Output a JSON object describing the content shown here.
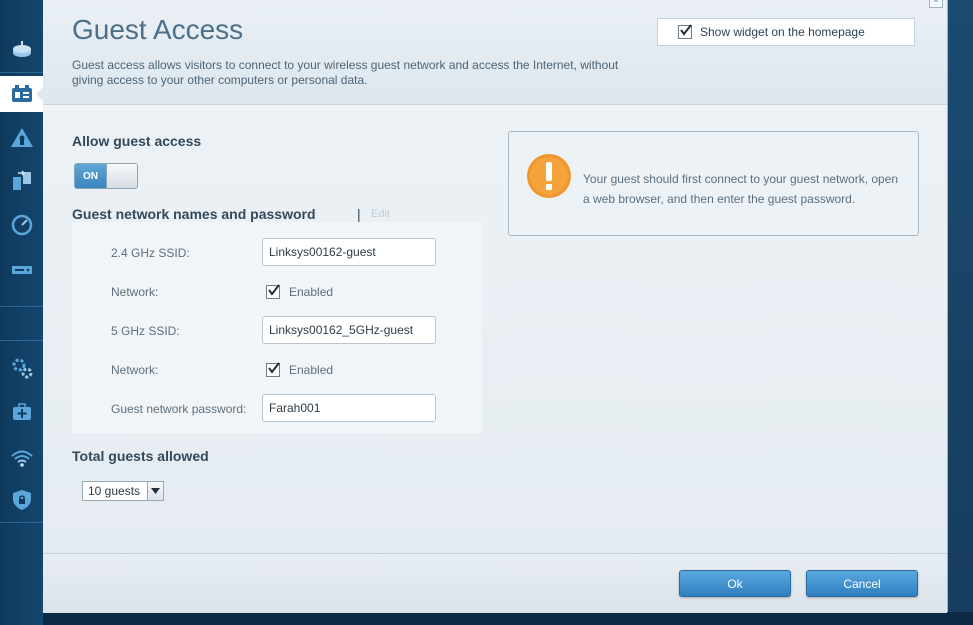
{
  "header": {
    "title": "Guest Access",
    "description": "Guest access allows visitors to connect to your wireless guest network and access the Internet, without giving access to your other computers or personal data.",
    "show_widget_label": "Show widget on the homepage",
    "show_widget_checked": true
  },
  "allow_guest": {
    "title": "Allow guest access",
    "toggle_label": "ON",
    "toggle_state": "on"
  },
  "network": {
    "title": "Guest network names and password",
    "separator": "|",
    "edit_label": "Edit",
    "ssid24_label": "2.4 GHz SSID:",
    "ssid24_value": "Linksys00162-guest",
    "network24_label": "Network:",
    "network24_checkbox_label": "Enabled",
    "ssid5_label": "5 GHz SSID:",
    "ssid5_value": "Linksys00162_5GHz-guest",
    "network5_label": "Network:",
    "network5_checkbox_label": "Enabled",
    "password_label": "Guest network password:",
    "password_value": "Farah001"
  },
  "guests": {
    "title": "Total guests allowed",
    "selected": "10 guests"
  },
  "info": {
    "message": "Your guest should first connect to your guest network, open a web browser, and then enter the guest password.",
    "icon": "warning-icon",
    "icon_color": "#f0962e"
  },
  "footer": {
    "ok_label": "Ok",
    "cancel_label": "Cancel"
  },
  "sidebar": {
    "items": [
      {
        "icon": "router-icon"
      },
      {
        "icon": "guest-access-icon",
        "active": true
      },
      {
        "icon": "parental-controls-icon"
      },
      {
        "icon": "media-prioritization-icon"
      },
      {
        "icon": "speed-test-icon"
      },
      {
        "icon": "external-storage-icon"
      },
      {
        "icon": "connectivity-icon"
      },
      {
        "icon": "troubleshooting-icon"
      },
      {
        "icon": "wireless-icon"
      },
      {
        "icon": "security-icon"
      }
    ]
  },
  "colors": {
    "accent": "#3a85bd",
    "sidebar": "#14466f",
    "title": "#4e6f88"
  }
}
